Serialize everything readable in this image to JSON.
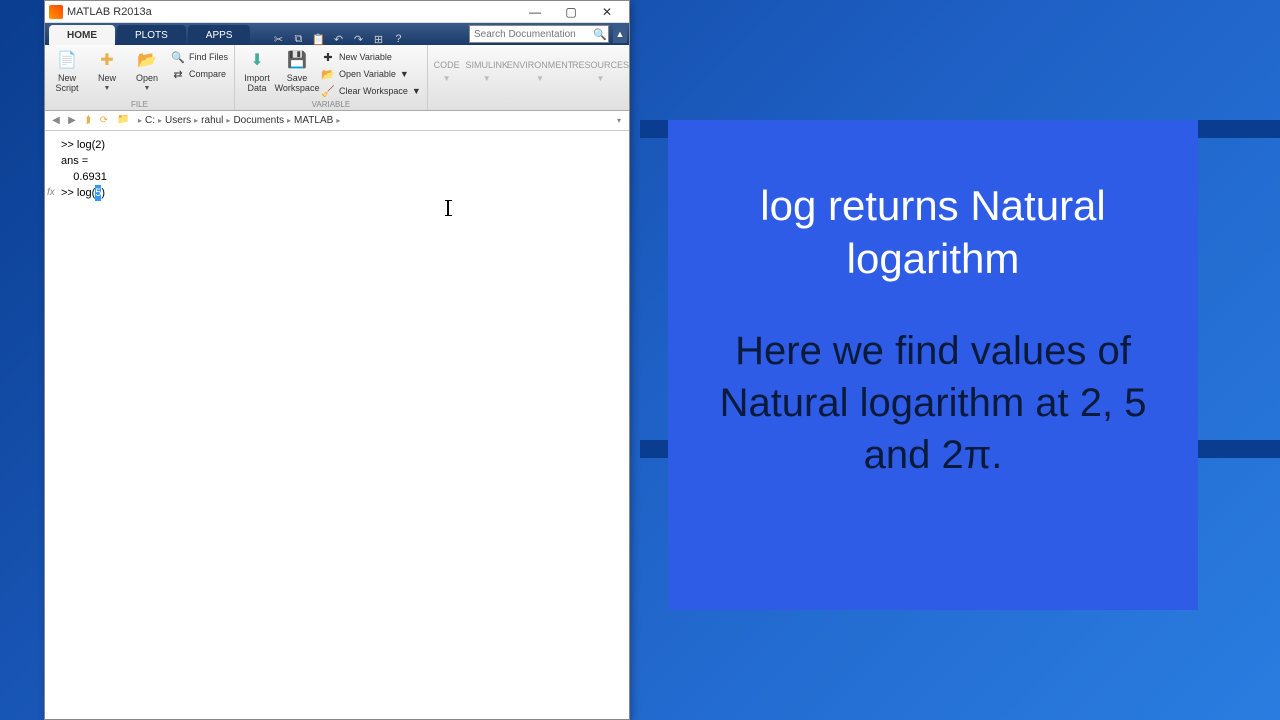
{
  "window": {
    "title": "MATLAB R2013a"
  },
  "tabs": {
    "home": "HOME",
    "plots": "PLOTS",
    "apps": "APPS"
  },
  "search": {
    "placeholder": "Search Documentation"
  },
  "ribbon": {
    "file": {
      "new_script": "New\nScript",
      "new": "New",
      "open": "Open",
      "find_files": "Find Files",
      "compare": "Compare",
      "group": "FILE"
    },
    "variable": {
      "import": "Import\nData",
      "save_ws": "Save\nWorkspace",
      "new_var": "New Variable",
      "open_var": "Open Variable",
      "clear_ws": "Clear Workspace",
      "group": "VARIABLE"
    },
    "code": "CODE",
    "simulink": "SIMULINK",
    "environment": "ENVIRONMENT",
    "resources": "RESOURCES"
  },
  "path": {
    "drive": "C:",
    "p1": "Users",
    "p2": "rahul",
    "p3": "Documents",
    "p4": "MATLAB"
  },
  "cmd": {
    "l1": ">> log(2)",
    "l2": "",
    "l3": "ans =",
    "l4": "",
    "l5": "    0.6931",
    "l6": "",
    "prompt": ">> ",
    "cur_before": "log(",
    "cur_sel": "5",
    "cur_after": ")"
  },
  "overlay": {
    "line1": "log returns Natural logarithm",
    "line2": "Here we find values of Natural logarithm at 2, 5 and 2π."
  }
}
